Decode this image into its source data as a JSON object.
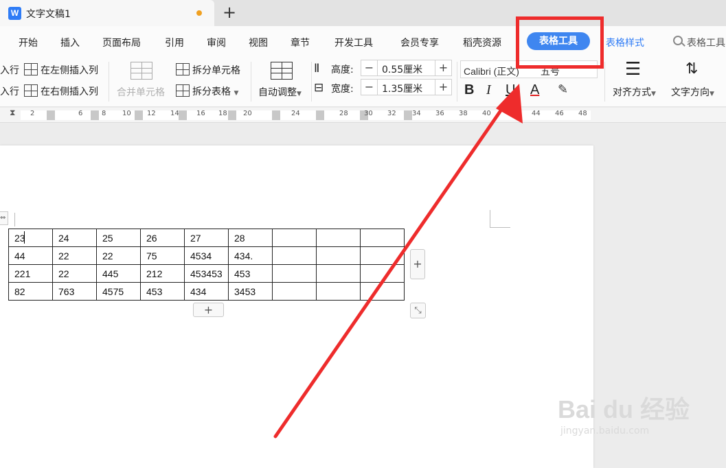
{
  "titlebar": {
    "doc_title": "文字文稿1",
    "app_icon_letter": "W",
    "new_tab_symbol": "+"
  },
  "menu": {
    "items": [
      "开始",
      "插入",
      "页面布局",
      "引用",
      "审阅",
      "视图",
      "章节",
      "开发工具",
      "会员专享",
      "稻壳资源"
    ],
    "active": "表格工具",
    "table_style": "表格样式",
    "search": "表格工具"
  },
  "toolbar": {
    "insert_row_above": "入行",
    "insert_row_below": "入行",
    "insert_col_left": "在左侧插入列",
    "insert_col_right": "在右侧插入列",
    "merge_cells": "合并单元格",
    "split_cells": "拆分单元格",
    "split_table": "拆分表格",
    "auto_fit": "自动调整",
    "height_label": "高度:",
    "height_value": "0.55厘米",
    "width_label": "宽度:",
    "width_value": "1.35厘米",
    "font_name": "Calibri (正文)",
    "font_size": "五号",
    "bold": "B",
    "italic": "I",
    "underline": "U",
    "font_color": "A",
    "align": "对齐方式",
    "text_direction": "文字方向"
  },
  "ruler": {
    "ticks": [
      "2",
      "6",
      "8",
      "10",
      "12",
      "14",
      "16",
      "18",
      "20",
      "24",
      "28",
      "30",
      "32",
      "34",
      "36",
      "38",
      "40",
      "42",
      "44",
      "46",
      "48"
    ]
  },
  "table": {
    "rows": [
      [
        "23",
        "24",
        "25",
        "26",
        "27",
        "28",
        "",
        "",
        ""
      ],
      [
        "44",
        "22",
        "22",
        "75",
        "4534",
        "434.",
        "",
        "",
        ""
      ],
      [
        "221",
        "22",
        "445",
        "212",
        "453453",
        "453",
        "",
        "",
        ""
      ],
      [
        "82",
        "763",
        "4575",
        "453",
        "434",
        "3453",
        "",
        "",
        ""
      ]
    ]
  },
  "controls": {
    "add_row": "+",
    "add_col": "+",
    "resize": "⤡",
    "move": "⇔"
  },
  "watermark": {
    "brand": "Bai du 经验",
    "url": "jingyan.baidu.com"
  },
  "colors": {
    "accent": "#3f86f0",
    "annotation": "#ee2c2c"
  }
}
